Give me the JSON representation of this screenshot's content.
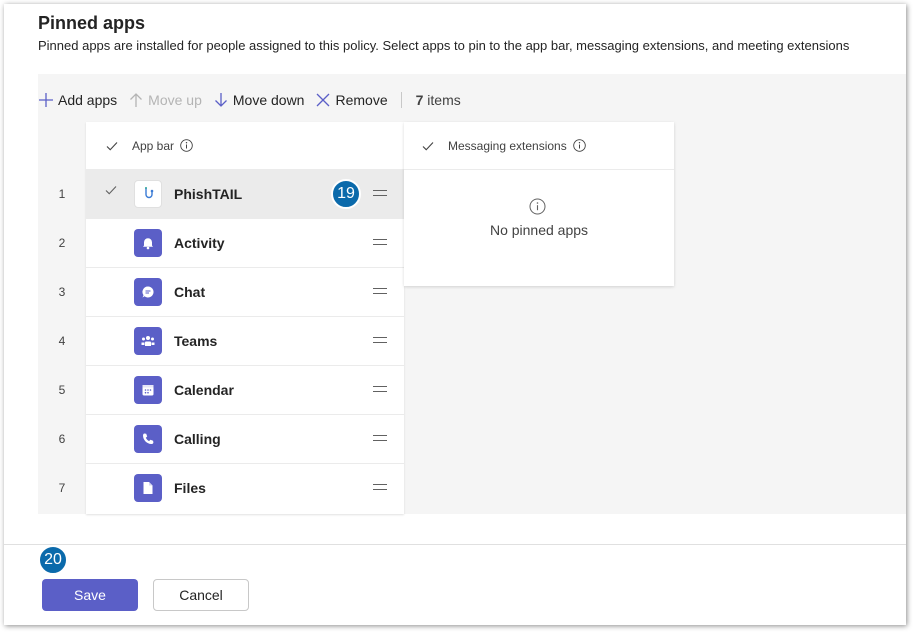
{
  "header": {
    "title": "Pinned apps",
    "description": "Pinned apps are installed for people assigned to this policy. Select apps to pin to the app bar, messaging extensions, and meeting extensions"
  },
  "toolbar": {
    "add_label": "Add apps",
    "move_up_label": "Move up",
    "move_down_label": "Move down",
    "remove_label": "Remove",
    "count_number": "7",
    "count_suffix": "items"
  },
  "app_bar": {
    "header": "App bar",
    "rows": [
      {
        "num": "1",
        "name": "PhishTAIL",
        "icon": "phishtail-icon",
        "selected": true
      },
      {
        "num": "2",
        "name": "Activity",
        "icon": "bell-icon",
        "selected": false
      },
      {
        "num": "3",
        "name": "Chat",
        "icon": "chat-icon",
        "selected": false
      },
      {
        "num": "4",
        "name": "Teams",
        "icon": "teams-icon",
        "selected": false
      },
      {
        "num": "5",
        "name": "Calendar",
        "icon": "calendar-icon",
        "selected": false
      },
      {
        "num": "6",
        "name": "Calling",
        "icon": "phone-icon",
        "selected": false
      },
      {
        "num": "7",
        "name": "Files",
        "icon": "file-icon",
        "selected": false
      }
    ]
  },
  "messaging_extensions": {
    "header": "Messaging extensions",
    "empty_text": "No pinned apps"
  },
  "badges": {
    "row_badge": "19",
    "footer_badge": "20"
  },
  "footer": {
    "save_label": "Save",
    "cancel_label": "Cancel"
  },
  "colors": {
    "accent": "#5b5fc7",
    "badge": "#0b6aab"
  }
}
